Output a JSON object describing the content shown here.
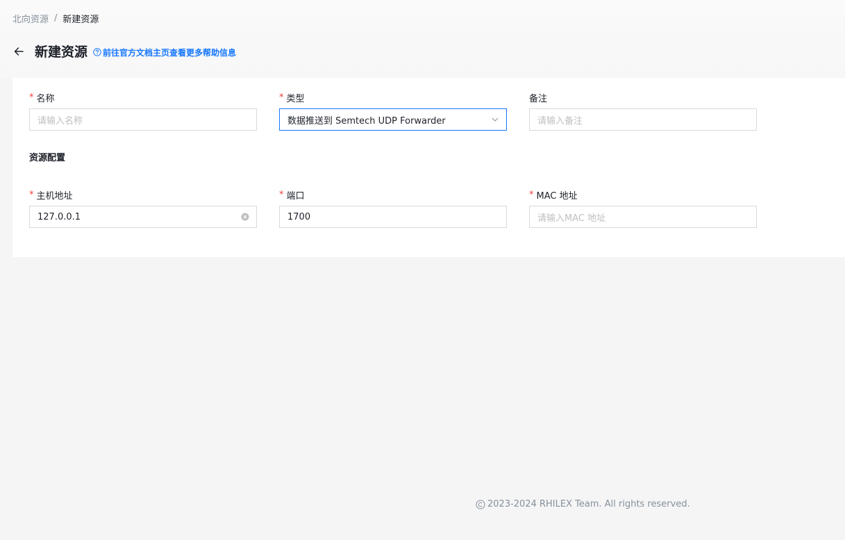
{
  "breadcrumb": {
    "parent": "北向资源",
    "separator": "/",
    "current": "新建资源"
  },
  "page": {
    "title": "新建资源",
    "help_link": "前往官方文档主页查看更多帮助信息"
  },
  "form": {
    "name": {
      "label": "名称",
      "required": true,
      "placeholder": "请输入名称",
      "value": ""
    },
    "type": {
      "label": "类型",
      "required": true,
      "value": "数据推送到 Semtech UDP Forwarder"
    },
    "remark": {
      "label": "备注",
      "required": false,
      "placeholder": "请输入备注",
      "value": ""
    },
    "section_title": "资源配置",
    "host": {
      "label": "主机地址",
      "required": true,
      "value": "127.0.0.1"
    },
    "port": {
      "label": "端口",
      "required": true,
      "value": "1700"
    },
    "mac": {
      "label": "MAC 地址",
      "required": true,
      "placeholder": "请输入MAC 地址",
      "value": ""
    }
  },
  "footer": {
    "text": "2023-2024 RHILEX Team. All rights reserved."
  },
  "colors": {
    "accent": "#1677ff",
    "required": "#f53f3f",
    "muted": "#86909c"
  }
}
